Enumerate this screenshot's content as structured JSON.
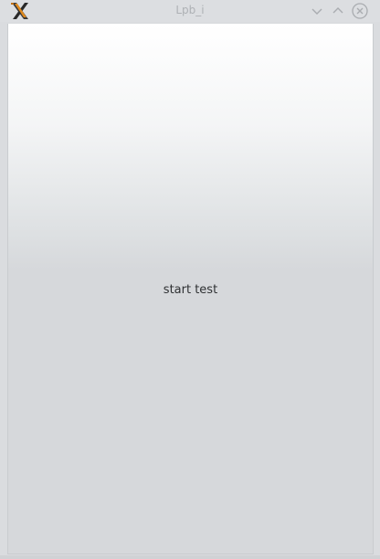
{
  "window": {
    "title": "Lpb_i",
    "icon": "x-window-system-icon",
    "controls": {
      "minimize": "chevron-down-icon",
      "maximize": "chevron-up-icon",
      "close": "close-icon"
    }
  },
  "main": {
    "start_button_label": "start test"
  },
  "colors": {
    "titlebar": "#dcdee1",
    "title_text": "#aeb1b5",
    "content_top": "#ffffff",
    "content_bottom": "#d6d8db",
    "button_text": "#2f3133"
  }
}
